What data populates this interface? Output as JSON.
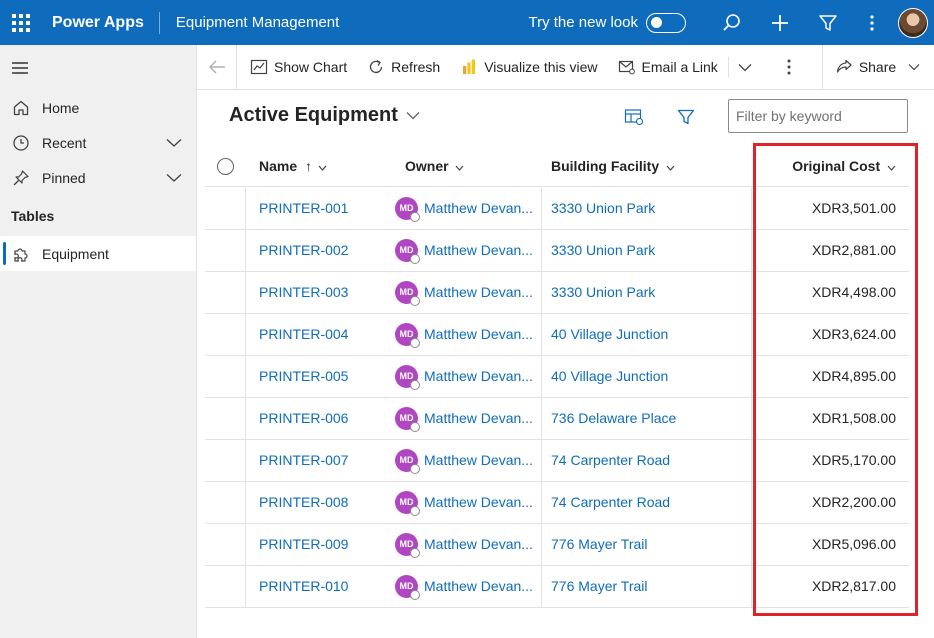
{
  "topbar": {
    "brand": "Power Apps",
    "app_name": "Equipment Management",
    "try_new_look": "Try the new look",
    "icons": [
      "waffle-icon",
      "search-icon",
      "plus-icon",
      "filter-icon",
      "more-icon"
    ]
  },
  "leftnav": {
    "items": [
      {
        "label": "Home",
        "icon": "home-icon"
      },
      {
        "label": "Recent",
        "icon": "clock-icon"
      },
      {
        "label": "Pinned",
        "icon": "pin-icon"
      }
    ],
    "section": "Tables",
    "tables": [
      {
        "label": "Equipment",
        "icon": "puzzle-icon"
      }
    ]
  },
  "commandbar": {
    "show_chart": "Show Chart",
    "refresh": "Refresh",
    "visualize": "Visualize this view",
    "email_link": "Email a Link",
    "share": "Share"
  },
  "view": {
    "title": "Active Equipment",
    "filter_placeholder": "Filter by keyword"
  },
  "grid": {
    "columns": {
      "name": "Name",
      "owner": "Owner",
      "building": "Building Facility",
      "cost": "Original Cost"
    },
    "rows": [
      {
        "name": "PRINTER-001",
        "owner_initials": "MD",
        "owner": "Matthew Devan...",
        "building": "3330 Union Park",
        "cost": "XDR3,501.00"
      },
      {
        "name": "PRINTER-002",
        "owner_initials": "MD",
        "owner": "Matthew Devan...",
        "building": "3330 Union Park",
        "cost": "XDR2,881.00"
      },
      {
        "name": "PRINTER-003",
        "owner_initials": "MD",
        "owner": "Matthew Devan...",
        "building": "3330 Union Park",
        "cost": "XDR4,498.00"
      },
      {
        "name": "PRINTER-004",
        "owner_initials": "MD",
        "owner": "Matthew Devan...",
        "building": "40 Village Junction",
        "cost": "XDR3,624.00"
      },
      {
        "name": "PRINTER-005",
        "owner_initials": "MD",
        "owner": "Matthew Devan...",
        "building": "40 Village Junction",
        "cost": "XDR4,895.00"
      },
      {
        "name": "PRINTER-006",
        "owner_initials": "MD",
        "owner": "Matthew Devan...",
        "building": "736 Delaware Place",
        "cost": "XDR1,508.00"
      },
      {
        "name": "PRINTER-007",
        "owner_initials": "MD",
        "owner": "Matthew Devan...",
        "building": "74 Carpenter Road",
        "cost": "XDR5,170.00"
      },
      {
        "name": "PRINTER-008",
        "owner_initials": "MD",
        "owner": "Matthew Devan...",
        "building": "74 Carpenter Road",
        "cost": "XDR2,200.00"
      },
      {
        "name": "PRINTER-009",
        "owner_initials": "MD",
        "owner": "Matthew Devan...",
        "building": "776 Mayer Trail",
        "cost": "XDR5,096.00"
      },
      {
        "name": "PRINTER-010",
        "owner_initials": "MD",
        "owner": "Matthew Devan...",
        "building": "776 Mayer Trail",
        "cost": "XDR2,817.00"
      }
    ]
  },
  "colors": {
    "brand_blue": "#0f6cbd",
    "link_blue": "#0f6cbd",
    "avatar_purple": "#b146c2",
    "highlight_red": "#e0232b"
  }
}
